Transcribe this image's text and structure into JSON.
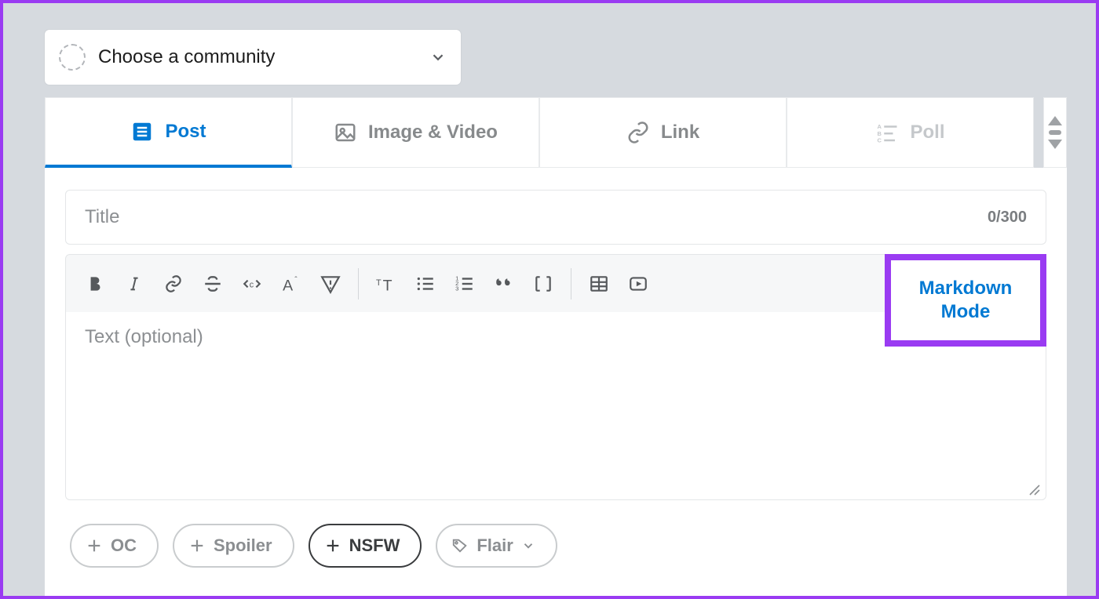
{
  "community": {
    "placeholder": "Choose a community"
  },
  "tabs": {
    "post": "Post",
    "image_video": "Image & Video",
    "link": "Link",
    "poll": "Poll"
  },
  "title": {
    "placeholder": "Title",
    "count": "0/300"
  },
  "markdown_button": {
    "line1": "Markdown",
    "line2": "Mode"
  },
  "body": {
    "placeholder": "Text (optional)"
  },
  "tags": {
    "oc": "OC",
    "spoiler": "Spoiler",
    "nsfw": "NSFW",
    "flair": "Flair"
  }
}
